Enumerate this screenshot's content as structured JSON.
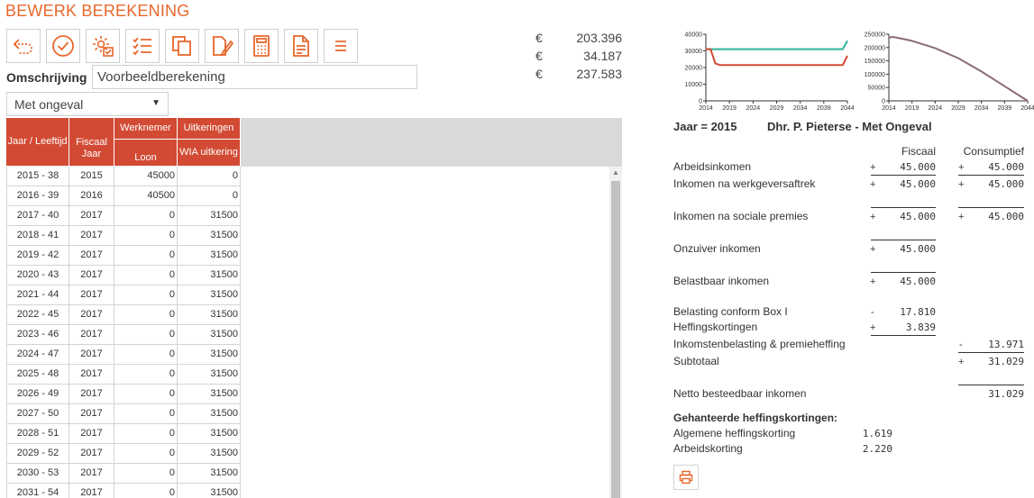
{
  "page_title": "BEWERK BEREKENING",
  "toolbar": [
    {
      "icon": "undo-icon"
    },
    {
      "icon": "check-circle-icon"
    },
    {
      "icon": "settings-check-icon"
    },
    {
      "icon": "checklist-icon"
    },
    {
      "icon": "copy-icon"
    },
    {
      "icon": "edit-document-icon"
    },
    {
      "icon": "calculator-icon"
    },
    {
      "icon": "document-icon"
    },
    {
      "icon": "menu-icon"
    }
  ],
  "omschrijving": {
    "label": "Omschrijving",
    "value": "Voorbeeldberekening"
  },
  "scenario_select": {
    "value": "Met ongeval"
  },
  "totals": [
    {
      "currency": "€",
      "value": "203.396"
    },
    {
      "currency": "€",
      "value": "34.187"
    },
    {
      "currency": "€",
      "value": "237.583"
    }
  ],
  "table": {
    "group_headers": {
      "werknemer": "Werknemer",
      "uitkeringen": "Uitkeringen"
    },
    "headers": {
      "jaar": "Jaar / Leeftijd",
      "fiscaal": "Fiscaal Jaar",
      "loon": "Loon",
      "wia": "WIA uitkering"
    },
    "rows": [
      [
        "2015 - 38",
        "2015",
        "45000",
        "0"
      ],
      [
        "2016 - 39",
        "2016",
        "40500",
        "0"
      ],
      [
        "2017 - 40",
        "2017",
        "0",
        "31500"
      ],
      [
        "2018 - 41",
        "2017",
        "0",
        "31500"
      ],
      [
        "2019 - 42",
        "2017",
        "0",
        "31500"
      ],
      [
        "2020 - 43",
        "2017",
        "0",
        "31500"
      ],
      [
        "2021 - 44",
        "2017",
        "0",
        "31500"
      ],
      [
        "2022 - 45",
        "2017",
        "0",
        "31500"
      ],
      [
        "2023 - 46",
        "2017",
        "0",
        "31500"
      ],
      [
        "2024 - 47",
        "2017",
        "0",
        "31500"
      ],
      [
        "2025 - 48",
        "2017",
        "0",
        "31500"
      ],
      [
        "2026 - 49",
        "2017",
        "0",
        "31500"
      ],
      [
        "2027 - 50",
        "2017",
        "0",
        "31500"
      ],
      [
        "2028 - 51",
        "2017",
        "0",
        "31500"
      ],
      [
        "2029 - 52",
        "2017",
        "0",
        "31500"
      ],
      [
        "2030 - 53",
        "2017",
        "0",
        "31500"
      ],
      [
        "2031 - 54",
        "2017",
        "0",
        "31500"
      ]
    ]
  },
  "chart_data": [
    {
      "type": "line",
      "x": [
        2014,
        2015,
        2016,
        2017,
        2018,
        2019,
        2020,
        2021,
        2022,
        2023,
        2024,
        2025,
        2026,
        2027,
        2028,
        2029,
        2030,
        2031,
        2032,
        2033,
        2034,
        2035,
        2036,
        2037,
        2038,
        2039,
        2040,
        2041,
        2042,
        2043,
        2044
      ],
      "xticks": [
        "2014",
        "2019",
        "2024",
        "2029",
        "2034",
        "2039",
        "2044"
      ],
      "yticks": [
        "0",
        "10000",
        "20000",
        "30000",
        "40000"
      ],
      "ylim": [
        0,
        40000
      ],
      "series": [
        {
          "color": "#2bb39a",
          "values": [
            31000,
            31000,
            31000,
            31000,
            31000,
            31000,
            31000,
            31000,
            31000,
            31000,
            31000,
            31000,
            31000,
            31000,
            31000,
            31000,
            31000,
            31000,
            31000,
            31000,
            31000,
            31000,
            31000,
            31000,
            31000,
            31000,
            31000,
            31000,
            31000,
            31000,
            36000
          ]
        },
        {
          "color": "#d24a33",
          "values": [
            31000,
            31000,
            22500,
            21500,
            21500,
            21500,
            21500,
            21500,
            21500,
            21500,
            21500,
            21500,
            21500,
            21500,
            21500,
            21500,
            21500,
            21500,
            21500,
            21500,
            21500,
            21500,
            21500,
            21500,
            21500,
            21500,
            21500,
            21500,
            21500,
            21500,
            27000
          ]
        }
      ]
    },
    {
      "type": "line",
      "x": [
        2014,
        2015,
        2019,
        2024,
        2029,
        2034,
        2039,
        2044
      ],
      "xticks": [
        "2014",
        "2019",
        "2024",
        "2029",
        "2034",
        "2039",
        "2044"
      ],
      "yticks": [
        "0",
        "50000",
        "100000",
        "150000",
        "200000",
        "250000"
      ],
      "ylim": [
        0,
        250000
      ],
      "series": [
        {
          "color": "#8a6b73",
          "values": [
            237583,
            240000,
            225000,
            198000,
            160000,
            110000,
            55000,
            0
          ]
        }
      ]
    }
  ],
  "summary": {
    "heading_year": "Jaar = 2015",
    "heading_name": "Dhr. P. Pieterse - Met Ongeval",
    "col_fiscaal": "Fiscaal",
    "col_consumptief": "Consumptief",
    "lines": {
      "arbeidsinkomen": {
        "label": "Arbeidsinkomen",
        "f_sign": "+",
        "f_val": "45.000",
        "c_sign": "+",
        "c_val": "45.000"
      },
      "na_werkgever": {
        "label": "Inkomen na werkgeversaftrek",
        "f_sign": "+",
        "f_val": "45.000",
        "c_sign": "+",
        "c_val": "45.000"
      },
      "na_sociale": {
        "label": "Inkomen na sociale premies",
        "f_sign": "+",
        "f_val": "45.000",
        "c_sign": "+",
        "c_val": "45.000"
      },
      "onzuiver": {
        "label": "Onzuiver inkomen",
        "f_sign": "+",
        "f_val": "45.000"
      },
      "belastbaar": {
        "label": "Belastbaar inkomen",
        "f_sign": "+",
        "f_val": "45.000"
      },
      "box1": {
        "label": "Belasting conform Box I",
        "f_sign": "-",
        "f_val": "17.810"
      },
      "heffingskortingen": {
        "label": "Heffingskortingen",
        "f_sign": "+",
        "f_val": "3.839"
      },
      "inkomstenbelasting": {
        "label": "Inkomstenbelasting & premieheffing",
        "c_sign": "-",
        "c_val": "13.971"
      },
      "subtotaal": {
        "label": "Subtotaal",
        "c_sign": "+",
        "c_val": "31.029"
      },
      "netto": {
        "label": "Netto besteedbaar inkomen",
        "c_val": "31.029"
      }
    },
    "gehanteerde": {
      "title": "Gehanteerde heffingskortingen:",
      "items": [
        {
          "label": "Algemene heffingskorting",
          "value": "1.619"
        },
        {
          "label": "Arbeidskorting",
          "value": "2.220"
        }
      ]
    }
  }
}
